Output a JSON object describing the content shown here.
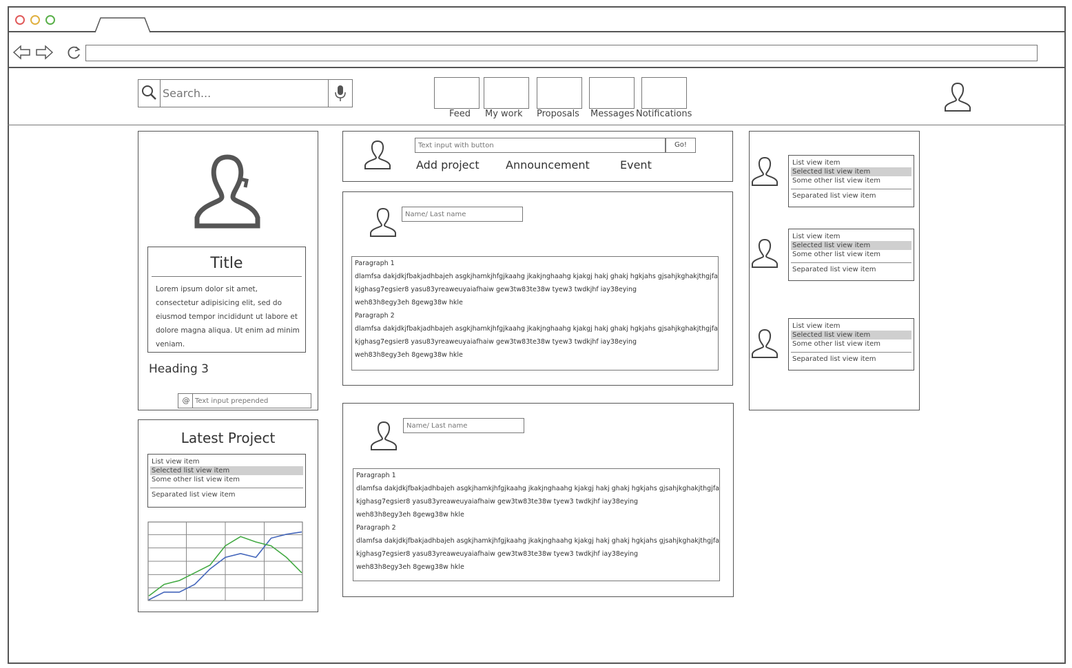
{
  "browser": {
    "controls": {
      "close_color": "#e05a5a",
      "minimize_color": "#e0b040",
      "maximize_color": "#5ab04a"
    }
  },
  "header": {
    "search": {
      "placeholder": "Search..."
    },
    "nav": [
      {
        "label": "Feed"
      },
      {
        "label": "My work"
      },
      {
        "label": "Proposals"
      },
      {
        "label": "Messages"
      },
      {
        "label": "Notifications"
      }
    ]
  },
  "profile_card": {
    "title": "Title",
    "body": "Lorem ipsum dolor sit amet, consectetur adipisicing elit, sed do eiusmod tempor incididunt ut labore et dolore magna aliqua. Ut enim ad minim veniam.",
    "heading3": "Heading 3",
    "prepended_input": {
      "placeholder": "Text input prepended"
    }
  },
  "latest_project": {
    "title": "Latest Project",
    "list": [
      "List view item",
      "Selected list view item",
      "Some other list view item",
      "Separated list view item"
    ],
    "chart_data": {
      "type": "line",
      "x": [
        0,
        1,
        2,
        3,
        4,
        5,
        6,
        7,
        8,
        9,
        10
      ],
      "series": [
        {
          "values": [
            0,
            1,
            1,
            2,
            4,
            5.5,
            6,
            5.5,
            8,
            8.5,
            8.8
          ],
          "color": "#4466bb"
        },
        {
          "values": [
            0.5,
            2,
            2.5,
            3.5,
            4.5,
            7,
            8.2,
            7.5,
            7,
            5.5,
            3.5
          ],
          "color": "#44aa44"
        }
      ],
      "ylim": [
        0,
        10
      ],
      "grid": true
    }
  },
  "composer": {
    "input": {
      "placeholder": "Text input with button"
    },
    "go_label": "Go!",
    "actions": [
      "Add project",
      "Announcement",
      "Event"
    ]
  },
  "posts": [
    {
      "name_placeholder": "Name/ Last name",
      "p1_label": "Paragraph 1",
      "p1_lines": [
        "dlamfsa dakjdkjfbakjadhbajeh asgkjhamkjhfgjkaahg jkakjnghaahg kjakgj hakj ghakj hgkjahs gjsahjkghakjthgjfah",
        "kjghasg7egsier8 yasu83yreaweuyaiafhaiw gew3tw83te38w tyew3 twdkjhf iay38eying",
        "weh83h8egy3eh 8gewg38w hkle"
      ],
      "p2_label": "Paragraph 2",
      "p2_lines": [
        "dlamfsa dakjdkjfbakjadhbajeh asgkjhamkjhfgjkaahg jkakjnghaahg kjakgj hakj ghakj hgkjahs gjsahjkghakjthgjfah",
        "kjghasg7egsier8 yasu83yreaweuyaiafhaiw gew3tw83te38w tyew3 twdkjhf iay38eying",
        "weh83h8egy3eh 8gewg38w hkle"
      ]
    },
    {
      "name_placeholder": "Name/ Last name",
      "p1_label": "Paragraph 1",
      "p1_lines": [
        "dlamfsa dakjdkjfbakjadhbajeh asgkjhamkjhfgjkaahg jkakjnghaahg kjakgj hakj ghakj hgkjahs gjsahjkghakjthgjfah",
        "kjghasg7egsier8 yasu83yreaweuyaiafhaiw gew3tw83te38w tyew3 twdkjhf iay38eying",
        "weh83h8egy3eh 8gewg38w hkle"
      ],
      "p2_label": "Paragraph 2",
      "p2_lines": [
        "dlamfsa dakjdkjfbakjadhbajeh asgkjhamkjhfgjkaahg jkakjnghaahg kjakgj hakj ghakj hgkjahs gjsahjkghakjthgjfah",
        "kjghasg7egsier8 yasu83yreaweuyaiafhaiw gew3tw83te38w tyew3 twdkjhf iay38eying",
        "weh83h8egy3eh 8gewg38w hkle"
      ]
    }
  ],
  "right_panel": {
    "lists": [
      [
        "List view item",
        "Selected list view item",
        "Some other list view item",
        "Separated list view item"
      ],
      [
        "List view item",
        "Selected list view item",
        "Some other list view item",
        "Separated list view item"
      ],
      [
        "List view item",
        "Selected list view item",
        "Some other list view item",
        "Separated list view item"
      ]
    ]
  }
}
